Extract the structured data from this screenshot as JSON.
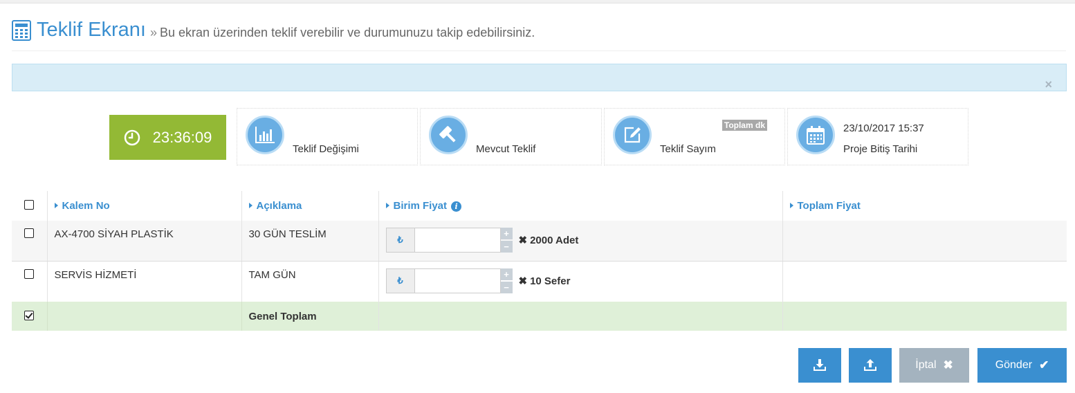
{
  "header": {
    "title": "Teklif Ekranı",
    "separator": "»",
    "subtitle": "Bu ekran üzerinden teklif verebilir ve durumunuzu takip edebilirsiniz."
  },
  "alert": {
    "close_label": "×"
  },
  "stats": {
    "timer": "23:36:09",
    "items": [
      {
        "label": "Teklif Değişimi",
        "icon": "bar-chart-icon"
      },
      {
        "label": "Mevcut Teklif",
        "icon": "gavel-icon"
      },
      {
        "label": "Teklif Sayım",
        "icon": "edit-icon",
        "badge": "Toplam dk"
      },
      {
        "label": "Proje Bitiş Tarihi",
        "value": "23/10/2017 15:37",
        "icon": "calendar-icon"
      }
    ]
  },
  "table": {
    "columns": [
      "Kalem No",
      "Açıklama",
      "Birim Fiyat",
      "Toplam Fiyat"
    ],
    "currency_symbol": "₺",
    "rows": [
      {
        "kalem_no": "AX-4700 SİYAH PLASTİK",
        "aciklama": "30 GÜN TESLİM",
        "birim_fiyat": "",
        "multiplier": "✖",
        "quantity": "2000 Adet",
        "toplam_fiyat": "",
        "checked": false
      },
      {
        "kalem_no": "SERVİS HİZMETİ",
        "aciklama": "TAM GÜN",
        "birim_fiyat": "",
        "multiplier": "✖",
        "quantity": "10 Sefer",
        "toplam_fiyat": "",
        "checked": false
      }
    ],
    "total_label": "Genel Toplam",
    "total_checked": true
  },
  "buttons": {
    "cancel": "İptal",
    "send": "Gönder"
  },
  "colors": {
    "accent": "#3a8fd0",
    "timer_bg": "#93b935",
    "total_row_bg": "#dff0d8",
    "alert_bg": "#d9edf7",
    "cancel_bg": "#a4b3bf"
  }
}
